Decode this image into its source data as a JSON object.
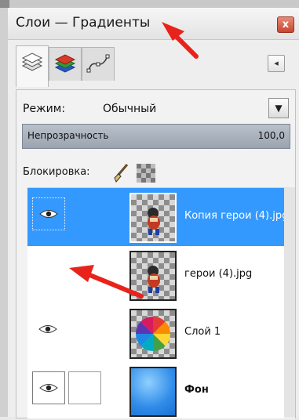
{
  "window": {
    "title": "Слои — Градиенты",
    "close_symbol": "x"
  },
  "tabs": [
    {
      "icon": "layers-icon"
    },
    {
      "icon": "channels-icon"
    },
    {
      "icon": "paths-icon"
    }
  ],
  "tab_menu_icon": "◂",
  "mode": {
    "label": "Режим:",
    "value": "Обычный",
    "dropdown_icon": "▼"
  },
  "opacity": {
    "label": "Непрозрачность",
    "value": "100,0"
  },
  "lock": {
    "label": "Блокировка:",
    "icons": [
      "brush-lock-icon",
      "alpha-lock-icon"
    ]
  },
  "layers": [
    {
      "name": "Копия герои (4).jpg",
      "visible": true,
      "selected": true,
      "bold": false,
      "thumb": "hero-checker"
    },
    {
      "name": "герои (4).jpg",
      "visible": false,
      "selected": false,
      "bold": false,
      "thumb": "hero-checker"
    },
    {
      "name": "Слой 1",
      "visible": true,
      "selected": false,
      "bold": false,
      "thumb": "color-wheel"
    },
    {
      "name": "Фон",
      "visible": true,
      "selected": false,
      "bold": true,
      "thumb": "blue-gradient"
    }
  ],
  "colors": {
    "selection": "#3399ff",
    "annotation_arrow": "#e8231c"
  }
}
